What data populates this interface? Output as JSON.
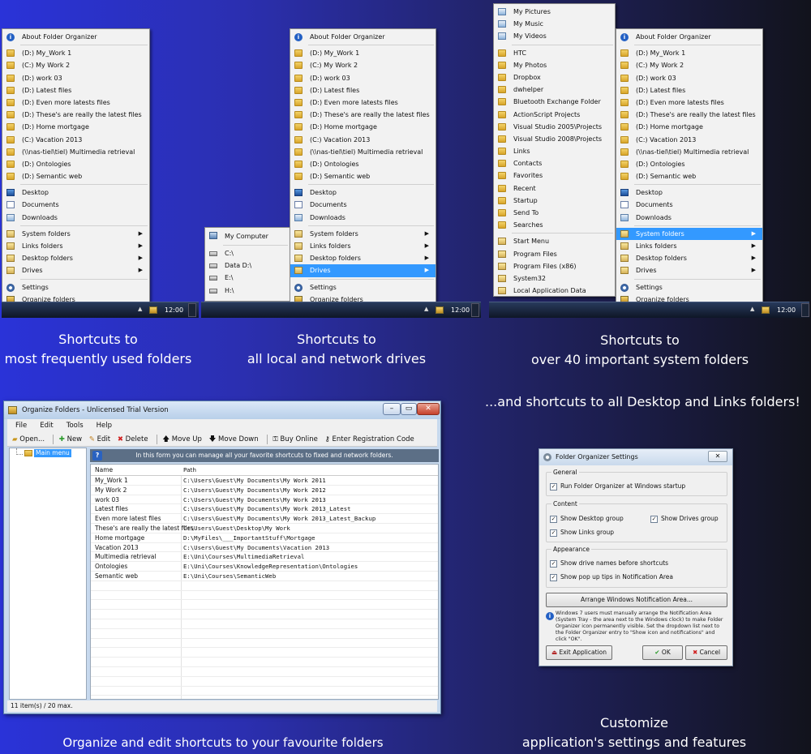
{
  "menu1": {
    "about": "About Folder Organizer",
    "folders": [
      "(D:) My_Work 1",
      "(C:) My Work 2",
      "(D:) work 03",
      "(D:) Latest files",
      "(D:) Even more latests files",
      "(D:) These's are really the latest files",
      "(D:) Home mortgage",
      "(C:) Vacation 2013",
      "(\\\\nas-tiel\\tiel) Multimedia retrieval",
      "(D:) Ontologies",
      "(D:) Semantic web"
    ],
    "std": [
      "Desktop",
      "Documents",
      "Downloads"
    ],
    "subs": [
      "System folders",
      "Links folders",
      "Desktop folders",
      "Drives"
    ],
    "bottom": [
      "Settings",
      "Organize folders"
    ]
  },
  "menu2": {
    "about": "About Folder Organizer",
    "folders": [
      "(D:) My_Work 1",
      "(C:) My Work 2",
      "(D:) work 03",
      "(D:) Latest files",
      "(D:) Even more latests files",
      "(D:) These's are really the latest files",
      "(D:) Home mortgage",
      "(C:) Vacation 2013",
      "(\\\\nas-tiel\\tiel) Multimedia retrieval",
      "(D:) Ontologies",
      "(D:) Semantic web"
    ],
    "std": [
      "Desktop",
      "Documents",
      "Downloads"
    ],
    "subs": [
      "System folders",
      "Links folders",
      "Desktop folders",
      "Drives"
    ],
    "bottom": [
      "Settings",
      "Organize folders"
    ]
  },
  "drives_menu": [
    "My Computer",
    "C:\\",
    "Data D:\\",
    "E:\\",
    "H:\\"
  ],
  "sys_menu": {
    "top": [
      "My Pictures",
      "My Music",
      "My Videos"
    ],
    "mid": [
      "HTC",
      "My Photos",
      "Dropbox",
      "dwhelper",
      "Bluetooth Exchange Folder",
      "ActionScript Projects",
      "Visual Studio 2005\\Projects",
      "Visual Studio 2008\\Projects",
      "Links",
      "Contacts",
      "Favorites",
      "Recent",
      "Startup",
      "Send To",
      "Searches"
    ],
    "bottom": [
      "Start Menu",
      "Program Files",
      "Program Files (x86)",
      "System32",
      "Local Application Data"
    ]
  },
  "menu3": {
    "about": "About Folder Organizer",
    "folders": [
      "(D:) My_Work 1",
      "(C:) My Work 2",
      "(D:) work 03",
      "(D:) Latest files",
      "(D:) Even more latests files",
      "(D:) These's are really the latest files",
      "(D:) Home mortgage",
      "(C:) Vacation 2013",
      "(\\\\nas-tiel\\tiel) Multimedia retrieval",
      "(D:) Ontologies",
      "(D:) Semantic web"
    ],
    "std": [
      "Desktop",
      "Documents",
      "Downloads"
    ],
    "subs": [
      "System folders",
      "Links folders",
      "Desktop folders",
      "Drives"
    ],
    "bottom": [
      "Settings",
      "Organize folders"
    ]
  },
  "taskbar": {
    "clock": "12:00"
  },
  "captions": {
    "c1a": "Shortcuts to",
    "c1b": "most frequently used folders",
    "c2a": "Shortcuts to",
    "c2b": "all local and network drives",
    "c3a": "Shortcuts to",
    "c3b": "over 40 important system folders",
    "c4": "...and shortcuts to all Desktop and Links folders!",
    "c5": "Organize and edit shortcuts to your favourite folders",
    "c6a": "Customize",
    "c6b": "application's settings and features"
  },
  "organizer": {
    "title": "Organize Folders - Unlicensed Trial Version",
    "menu": [
      "File",
      "Edit",
      "Tools",
      "Help"
    ],
    "toolbar": [
      "Open...",
      "New",
      "Edit",
      "Delete",
      "Move Up",
      "Move Down",
      "Buy Online",
      "Enter Registration Code"
    ],
    "tree_root": "Main menu",
    "info": "In this form you can manage all your favorite shortcuts to fixed and network folders.",
    "col_name": "Name",
    "col_path": "Path",
    "rows": [
      {
        "name": "My_Work 1",
        "path": "C:\\Users\\Guest\\My Documents\\My Work 2011"
      },
      {
        "name": "My Work 2",
        "path": "C:\\Users\\Guest\\My Documents\\My Work 2012"
      },
      {
        "name": "work 03",
        "path": "C:\\Users\\Guest\\My Documents\\My Work 2013"
      },
      {
        "name": "Latest files",
        "path": "C:\\Users\\Guest\\My Documents\\My Work 2013_Latest"
      },
      {
        "name": "Even more latest files",
        "path": "C:\\Users\\Guest\\My Documents\\My Work 2013_Latest_Backup"
      },
      {
        "name": "These's are really the latest files",
        "path": "C:\\Users\\Guest\\Desktop\\My Work"
      },
      {
        "name": "Home mortgage",
        "path": "D:\\MyFiles\\___ImportantStuff\\Mortgage"
      },
      {
        "name": "Vacation 2013",
        "path": "C:\\Users\\Guest\\My Documents\\Vacation 2013"
      },
      {
        "name": "Multimedia retrieval",
        "path": "E:\\Uni\\Courses\\MultimediaRetrieval"
      },
      {
        "name": "Ontologies",
        "path": "E:\\Uni\\Courses\\KnowledgeRepresentation\\Ontologies"
      },
      {
        "name": "Semantic web",
        "path": "E:\\Uni\\Courses\\SemanticWeb"
      }
    ],
    "status": "11 item(s) / 20 max."
  },
  "settings": {
    "title": "Folder Organizer Settings",
    "general": "General",
    "run_startup": "Run Folder Organizer at Windows startup",
    "content": "Content",
    "show_desktop": "Show Desktop group",
    "show_drives": "Show Drives group",
    "show_links": "Show Links group",
    "appearance": "Appearance",
    "show_drive_names": "Show drive names before shortcuts",
    "show_popup": "Show pop up tips in Notification Area",
    "arrange": "Arrange Windows Notification Area...",
    "note": "Windows 7 users must manually arrange the Notification Area (System Tray - the area next to the Windows clock) to make Folder Organizer icon permanently visible. Set the dropdown list next to the Folder Organizer entry to \"Show icon and notifications\" and click \"OK\".",
    "exit": "Exit Application",
    "ok": "OK",
    "cancel": "Cancel"
  }
}
